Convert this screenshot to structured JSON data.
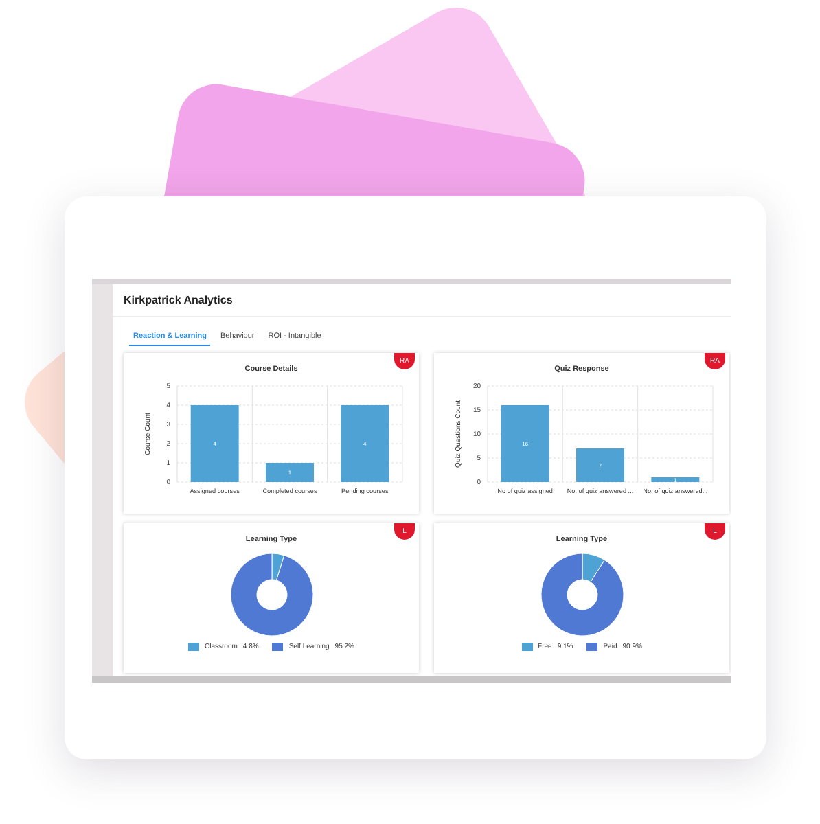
{
  "app": {
    "title": "Kirkpatrick Analytics"
  },
  "tabs": [
    {
      "label": "Reaction & Learning",
      "selected": true
    },
    {
      "label": "Behaviour",
      "selected": false
    },
    {
      "label": "ROI - Intangible",
      "selected": false
    }
  ],
  "cards": [
    {
      "title": "Course Details",
      "badge": "RA",
      "chart_data": {
        "type": "bar",
        "ylabel": "Course Count",
        "categories": [
          "Assigned courses",
          "Completed courses",
          "Pending courses"
        ],
        "series": [
          {
            "color": "#4ea3d4",
            "values": [
              4,
              1,
              4
            ]
          }
        ],
        "ylim": [
          0,
          5
        ],
        "yticks": [
          0,
          1,
          2,
          3,
          4,
          5
        ],
        "grid": true,
        "data_labels": true
      }
    },
    {
      "title": "Quiz Response",
      "badge": "RA",
      "chart_data": {
        "type": "bar",
        "ylabel": "Quiz Questions Count",
        "categories": [
          "No of quiz assigned",
          "No. of quiz answered ...",
          "No. of quiz answered..."
        ],
        "series": [
          {
            "color": "#4ea3d4",
            "values": [
              16,
              7,
              1
            ]
          }
        ],
        "ylim": [
          0,
          20
        ],
        "yticks": [
          0,
          5,
          10,
          15,
          20
        ],
        "grid": true,
        "data_labels": true
      }
    },
    {
      "title": "Learning Type",
      "badge": "L",
      "chart_data": {
        "type": "donut",
        "categories": [
          "Classroom",
          "Self Learning"
        ],
        "series": [
          {
            "values": [
              4.8,
              95.2
            ]
          }
        ]
      },
      "legend": [
        {
          "value": "4.8%",
          "color": "#4ea3d4"
        },
        {
          "value": "95.2%",
          "color": "#5079d3"
        }
      ]
    },
    {
      "title": "Learning Type",
      "badge": "L",
      "chart_data": {
        "type": "donut",
        "categories": [
          "Free",
          "Paid"
        ],
        "series": [
          {
            "values": [
              9.1,
              90.9
            ]
          }
        ]
      },
      "legend": [
        {
          "value": "9.1%",
          "color": "#4ea3d4"
        },
        {
          "value": "90.9%",
          "color": "#5079d3"
        }
      ]
    }
  ]
}
